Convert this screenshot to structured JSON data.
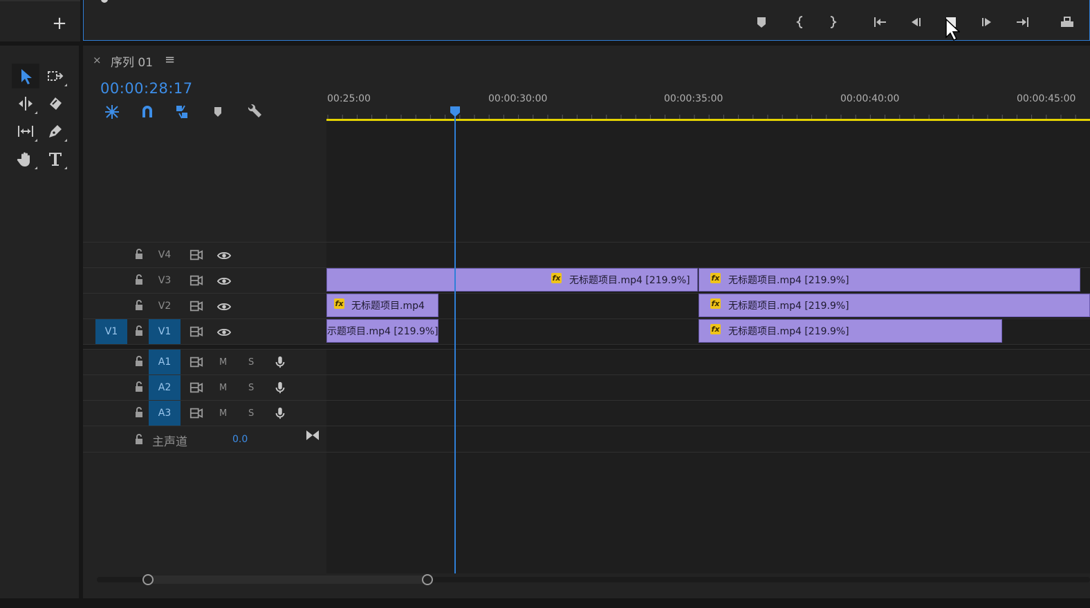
{
  "monitor": {
    "add_label": "+",
    "buttons": [
      "add-marker",
      "mark-in",
      "mark-out",
      "go-to-in",
      "step-back",
      "stop",
      "step-forward",
      "go-to-out",
      "lift"
    ]
  },
  "tools": [
    "selection",
    "track-select-forward",
    "ripple-edit",
    "razor",
    "slip",
    "pen",
    "hand",
    "type"
  ],
  "sequence": {
    "close_label": "×",
    "title": "序列 01",
    "menu_label": "≡",
    "timecode": "00:00:28:17",
    "controls": [
      "nest-toggle",
      "snap-magnet",
      "linked-selection",
      "add-marker",
      "timeline-settings"
    ]
  },
  "ruler": {
    "labels": [
      "00:25:00",
      "00:00:30:00",
      "00:00:35:00",
      "00:00:40:00",
      "00:00:45:00"
    ],
    "playhead": "00:00:28:17"
  },
  "tracks": {
    "video": [
      {
        "label": "V4",
        "source": ""
      },
      {
        "label": "V3",
        "source": ""
      },
      {
        "label": "V2",
        "source": ""
      },
      {
        "label": "V1",
        "source": "V1"
      }
    ],
    "audio": [
      {
        "label": "A1",
        "mute": "M",
        "solo": "S"
      },
      {
        "label": "A2",
        "mute": "M",
        "solo": "S"
      },
      {
        "label": "A3",
        "mute": "M",
        "solo": "S"
      }
    ],
    "master": {
      "label": "主声道",
      "value": "0.0"
    }
  },
  "clips": {
    "v3_a": "无标题项目.mp4 [219.9%]",
    "v3_b": "无标题项目.mp4 [219.9%]",
    "v2_a": "无标题项目.mp4",
    "v2_b": "无标题项目.mp4 [219.9%]",
    "v1_a": "示题项目.mp4 [219.9%]",
    "v1_b": "无标题项目.mp4 [219.9%]",
    "fx_label": "fx"
  },
  "colors": {
    "accent": "#3d8ee8",
    "clip": "#a08ee0",
    "work_area": "#e5d300",
    "track_target": "#0f5080"
  }
}
